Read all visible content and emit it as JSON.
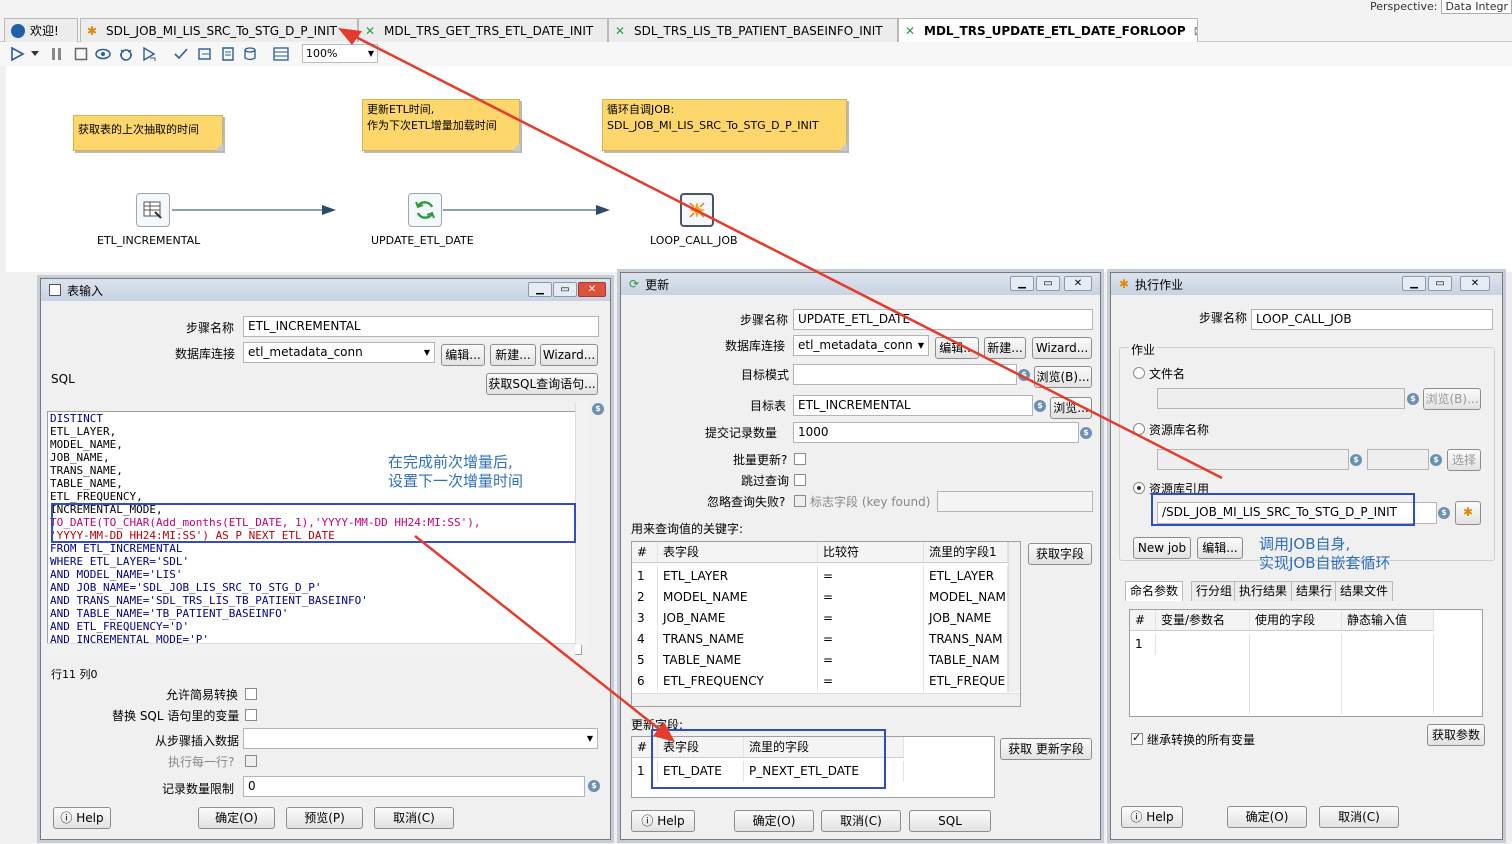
{
  "tabs": [
    {
      "label": "欢迎!"
    },
    {
      "label": "SDL_JOB_MI_LIS_SRC_To_STG_D_P_INIT"
    },
    {
      "label": "MDL_TRS_GET_TRS_ETL_DATE_INIT"
    },
    {
      "label": "SDL_TRS_LIS_TB_PATIENT_BASEINFO_INIT"
    },
    {
      "label": "MDL_TRS_UPDATE_ETL_DATE_FORLOOP"
    }
  ],
  "perspective": {
    "label": "Perspective:",
    "value": "Data Integr"
  },
  "zoom": "100%",
  "notes": [
    "获取表的上次抽取的时间",
    "更新ETL时间,\n作为下次ETL增量加载时间",
    "循环自调JOB:\nSDL_JOB_MI_LIS_SRC_To_STG_D_P_INIT"
  ],
  "steps": [
    "ETL_INCREMENTAL",
    "UPDATE_ETL_DATE",
    "LOOP_CALL_JOB"
  ],
  "colors": {
    "note": "#fdd66c",
    "annotation": "#2e6fbd",
    "highlight": "#2d4fc2",
    "arrow": "#e53b2c"
  },
  "dlg1": {
    "title": "表输入",
    "step_label": "步骤名称",
    "step_value": "ETL_INCREMENTAL",
    "db_label": "数据库连接",
    "db_value": "etl_metadata_conn",
    "edit": "编辑...",
    "new": "新建...",
    "wizard": "Wizard...",
    "sql_label": "SQL",
    "get_sql": "获取SQL查询语句...",
    "sql_lines": [
      "DISTINCT",
      "ETL_LAYER,",
      "MODEL_NAME,",
      "JOB_NAME,",
      "TRANS_NAME,",
      "TABLE_NAME,",
      "ETL_FREQUENCY,",
      "INCREMENTAL_MODE,",
      "TO_DATE(TO_CHAR(Add_months(ETL_DATE, 1),'YYYY-MM-DD HH24:MI:SS'),",
      "'YYYY-MM-DD HH24:MI:SS') AS P_NEXT_ETL_DATE",
      "FROM ETL_INCREMENTAL",
      "WHERE ETL_LAYER='SDL'",
      "AND MODEL_NAME='LIS'",
      "AND JOB_NAME='SDL_JOB_LIS_SRC_TO_STG_D_P'",
      "AND TRANS_NAME='SDL_TRS_LIS_TB_PATIENT_BASEINFO'",
      "AND TABLE_NAME='TB_PATIENT_BASEINFO'",
      "AND ETL_FREQUENCY='D'",
      "AND INCREMENTAL_MODE='P'"
    ],
    "annotation": "在完成前次增量后,\n设置下一次增量时间",
    "cursor": "行11 列0",
    "lazy": "允许简易转换",
    "replace_vars": "替换 SQL 语句里的变量",
    "insert_from": "从步骤插入数据",
    "each_row": "执行每一行?",
    "limit_label": "记录数量限制",
    "limit_value": "0",
    "help": "Help",
    "ok": "确定(O)",
    "preview": "预览(P)",
    "cancel": "取消(C)"
  },
  "dlg2": {
    "title": "更新",
    "step_label": "步骤名称",
    "step_value": "UPDATE_ETL_DATE",
    "db_label": "数据库连接",
    "db_value": "etl_metadata_conn",
    "edit": "编辑...",
    "new": "新建...",
    "wizard": "Wizard...",
    "schema_label": "目标模式",
    "browse_b": "浏览(B)...",
    "table_label": "目标表",
    "table_value": "ETL_INCREMENTAL",
    "browse": "浏览...",
    "commit_label": "提交记录数量",
    "commit_value": "1000",
    "batch": "批量更新?",
    "skip": "跳过查询",
    "ignore": "忽略查询失败?",
    "flag_field": "标志字段 (key found)",
    "keys_title": "用来查询值的关键字:",
    "keys_headers": [
      "#",
      "表字段",
      "比较符",
      "流里的字段1"
    ],
    "keys_rows": [
      [
        "1",
        "ETL_LAYER",
        "=",
        "ETL_LAYER"
      ],
      [
        "2",
        "MODEL_NAME",
        "=",
        "MODEL_NAM"
      ],
      [
        "3",
        "JOB_NAME",
        "=",
        "JOB_NAME"
      ],
      [
        "4",
        "TRANS_NAME",
        "=",
        "TRANS_NAM"
      ],
      [
        "5",
        "TABLE_NAME",
        "=",
        "TABLE_NAM"
      ],
      [
        "6",
        "ETL_FREQUENCY",
        "=",
        "ETL_FREQUE"
      ]
    ],
    "get_fields": "获取字段",
    "update_title": "更新字段:",
    "update_headers": [
      "#",
      "表字段",
      "流里的字段"
    ],
    "update_rows": [
      [
        "1",
        "ETL_DATE",
        "P_NEXT_ETL_DATE"
      ]
    ],
    "get_update": "获取 更新字段",
    "help": "Help",
    "ok": "确定(O)",
    "cancel": "取消(C)",
    "sql": "SQL"
  },
  "dlg3": {
    "title": "执行作业",
    "step_label": "步骤名称",
    "step_value": "LOOP_CALL_JOB",
    "job_group": "作业",
    "filename": "文件名",
    "browse_b": "浏览(B)...",
    "repo_name": "资源库名称",
    "select": "选择",
    "repo_ref": "资源库引用",
    "repo_value": "/SDL_JOB_MI_LIS_SRC_To_STG_D_P_INIT",
    "new_job": "New job",
    "edit": "编辑...",
    "annotation": "调用JOB自身,\n实现JOB自嵌套循环",
    "subtabs": [
      "命名参数",
      "行分组",
      "执行结果",
      "结果行",
      "结果文件"
    ],
    "param_headers": [
      "#",
      "变量/参数名",
      "使用的字段",
      "静态输入值"
    ],
    "param_rows": [
      [
        "1",
        "",
        "",
        ""
      ]
    ],
    "inherit": "继承转换的所有变量",
    "get_params": "获取参数",
    "help": "Help",
    "ok": "确定(O)",
    "cancel": "取消(C)"
  }
}
